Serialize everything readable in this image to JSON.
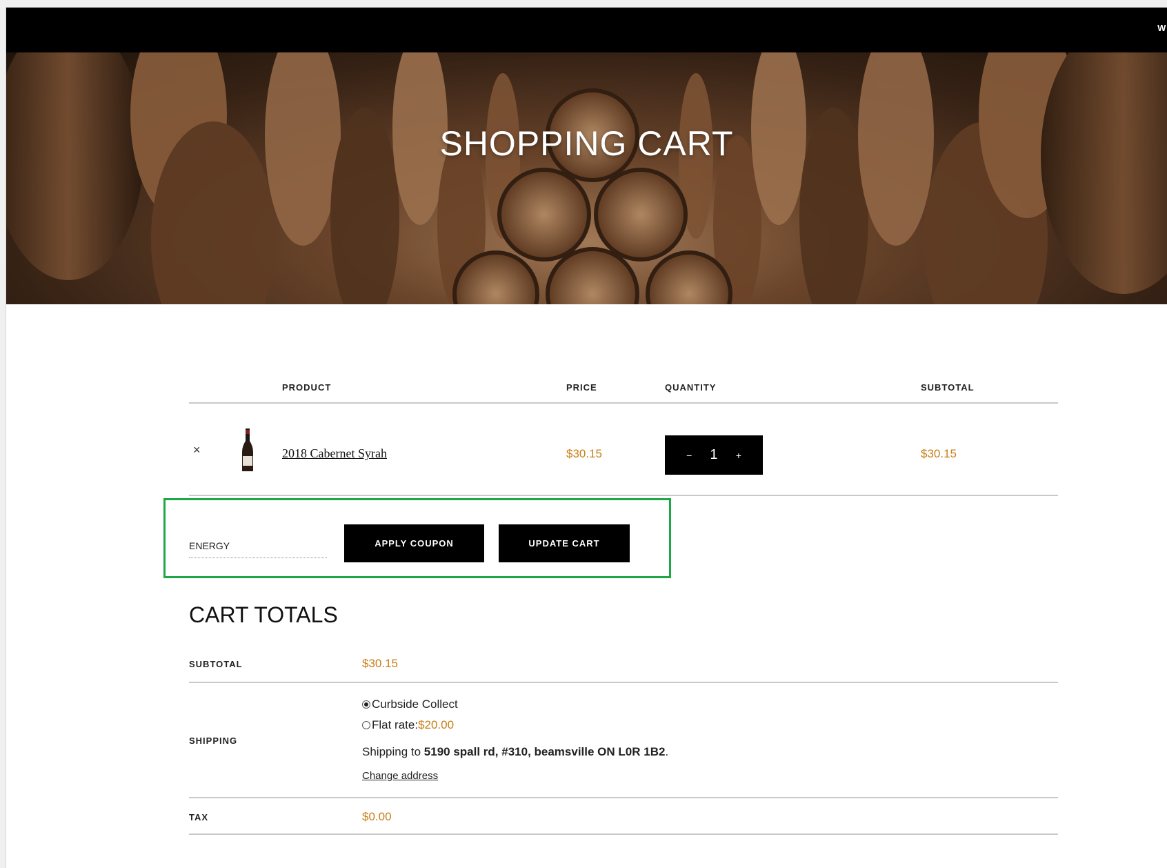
{
  "topbar": {
    "text": "WI"
  },
  "hero": {
    "title": "SHOPPING CART"
  },
  "table": {
    "headers": {
      "product": "PRODUCT",
      "price": "PRICE",
      "quantity": "QUANTITY",
      "subtotal": "SUBTOTAL"
    },
    "item": {
      "remove": "×",
      "name": "2018 Cabernet Syrah",
      "price": "$30.15",
      "qty_minus": "−",
      "qty_value": "1",
      "qty_plus": "+",
      "subtotal": "$30.15"
    }
  },
  "coupon": {
    "value": "ENERGY",
    "apply_label": "APPLY COUPON",
    "update_label": "UPDATE CART"
  },
  "totals": {
    "title": "CART TOTALS",
    "subtotal_label": "SUBTOTAL",
    "subtotal_value": "$30.15",
    "shipping_label": "SHIPPING",
    "option1": "Curbside Collect",
    "option2_label": "Flat rate: ",
    "option2_price": "$20.00",
    "ship_to_prefix": "Shipping to ",
    "ship_to_address": "5190 spall rd, #310, beamsville ON L0R 1B2",
    "ship_to_suffix": ".",
    "change_address": "Change address",
    "tax_label": "TAX",
    "tax_value": "$0.00"
  },
  "colors": {
    "accent": "#c97d14",
    "highlight_box": "#1fa647"
  }
}
